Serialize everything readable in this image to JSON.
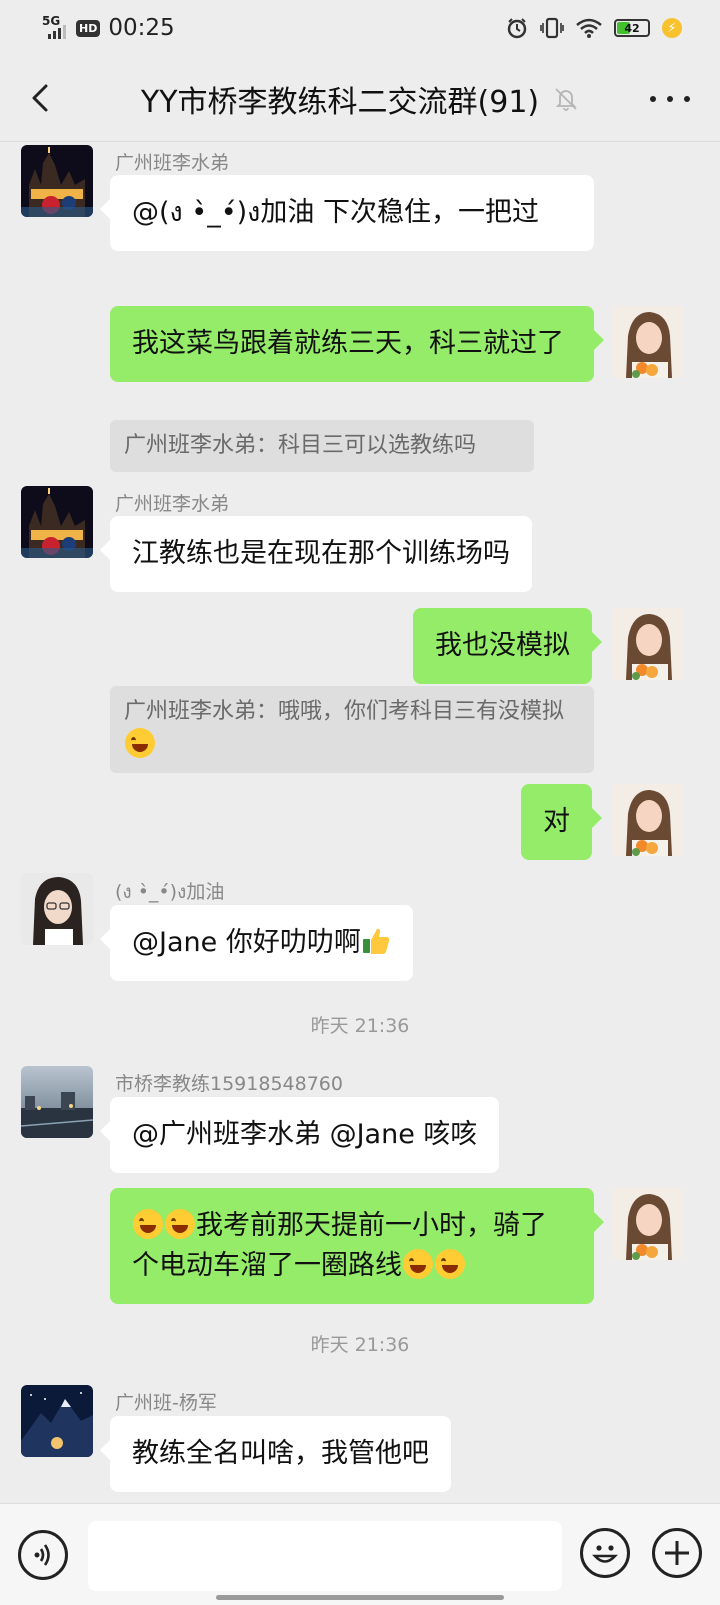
{
  "status_bar": {
    "network": "5G",
    "hd": "HD",
    "time": "00:25",
    "battery": "42"
  },
  "header": {
    "title": "YY市桥李教练科二交流群(91)"
  },
  "messages": {
    "m1": {
      "sender": "广州班李水弟",
      "text": "@(ง •̀_•́)ง加油 下次稳住，一把过"
    },
    "m2": {
      "text": "我这菜鸟跟着就练三天，科三就过了"
    },
    "q1": {
      "text": "广州班李水弟：科目三可以选教练吗"
    },
    "m3": {
      "sender": "广州班李水弟",
      "text": "江教练也是在现在那个训练场吗"
    },
    "m4": {
      "text": "我也没模拟"
    },
    "q2": {
      "text": "广州班李水弟：哦哦，你们考科目三有没模拟"
    },
    "m5": {
      "text": "对"
    },
    "m6": {
      "sender": "(ง •̀_•́)ง加油",
      "text": "@Jane  你好叻叻啊"
    },
    "t1": {
      "text": "昨天 21:36"
    },
    "m7": {
      "sender": "市桥李教练15918548760",
      "text": "@广州班李水弟  @Jane  咳咳"
    },
    "m8": {
      "text": "我考前那天提前一小时，骑了个电动车溜了一圈路线"
    },
    "t2": {
      "text": "昨天 21:36"
    },
    "m9": {
      "sender": "广州班-杨军",
      "text": "教练全名叫啥，我管他吧"
    }
  },
  "input_bar": {
    "placeholder": ""
  }
}
